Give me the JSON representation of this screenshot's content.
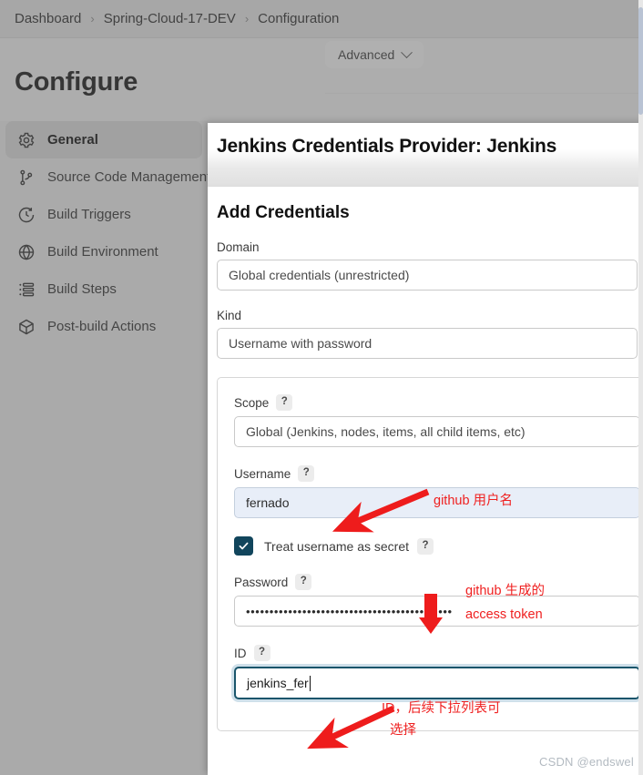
{
  "breadcrumb": {
    "items": [
      "Dashboard",
      "Spring-Cloud-17-DEV",
      "Configuration"
    ],
    "separator": "›"
  },
  "toolbar": {
    "advanced_label": "Advanced",
    "advanced_icon": "chevron-down-icon"
  },
  "page": {
    "title": "Configure"
  },
  "sidebar": {
    "items": [
      {
        "label": "General",
        "icon": "gear-icon",
        "active": true
      },
      {
        "label": "Source Code Management",
        "icon": "branch-icon",
        "active": false
      },
      {
        "label": "Build Triggers",
        "icon": "clock-icon",
        "active": false
      },
      {
        "label": "Build Environment",
        "icon": "globe-icon",
        "active": false
      },
      {
        "label": "Build Steps",
        "icon": "list-icon",
        "active": false
      },
      {
        "label": "Post-build Actions",
        "icon": "package-icon",
        "active": false
      }
    ]
  },
  "modal": {
    "title": "Jenkins Credentials Provider: Jenkins",
    "section_title": "Add Credentials",
    "fields": {
      "domain": {
        "label": "Domain",
        "value": "Global credentials (unrestricted)"
      },
      "kind": {
        "label": "Kind",
        "value": "Username with password"
      },
      "scope": {
        "label": "Scope",
        "help": "?",
        "value": "Global (Jenkins, nodes, items, all child items, etc)"
      },
      "username": {
        "label": "Username",
        "help": "?",
        "value": "fernado"
      },
      "treat_secret": {
        "label": "Treat username as secret",
        "help": "?",
        "checked": true,
        "check_icon": "check-icon"
      },
      "password": {
        "label": "Password",
        "help": "?",
        "value": "••••••••••••••••••••••••••••••••••••••••••••"
      },
      "id": {
        "label": "ID",
        "help": "?",
        "value": "jenkins_fer"
      }
    }
  },
  "annotations": {
    "username_note": "github 用户名",
    "password_note_line1": "github 生成的",
    "password_note_line2": "access token",
    "id_note_line1": "ID，后续下拉列表可",
    "id_note_line2": "选择",
    "color": "#ef2020"
  },
  "watermark": {
    "text": "CSDN @endswel"
  }
}
